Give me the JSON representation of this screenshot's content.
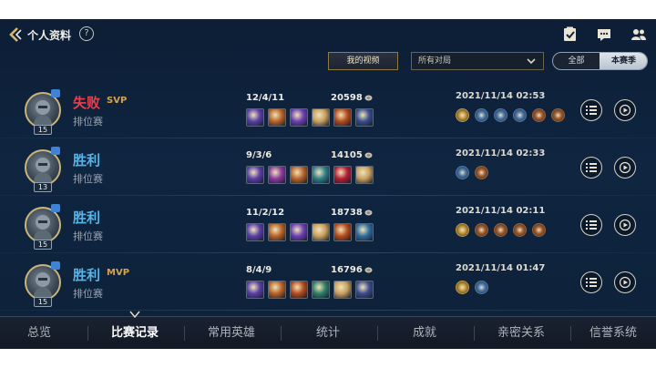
{
  "header": {
    "title": "个人资料",
    "help_symbol": "?",
    "icons": [
      "back-arrow-icon",
      "clipboard-check-icon",
      "chat-icon",
      "friends-icon"
    ]
  },
  "controls": {
    "video_button": "我的视频",
    "filter_value": "所有对局",
    "season_toggle": {
      "all": "全部",
      "current": "本赛季",
      "selected": "本赛季"
    }
  },
  "matches": [
    {
      "result": "失败",
      "result_type": "lose",
      "mvp": "SVP",
      "mvp_color": "#d9a24a",
      "mode": "排位赛",
      "level": "15",
      "kda": "12/4/11",
      "gold": "20598",
      "datetime": "2021/11/14 02:53",
      "items": [
        "#5a3fa8",
        "#b8642a",
        "#6b3fb3",
        "#c9a061",
        "#b54b1c",
        "#3a4e8f"
      ],
      "medals": [
        "gold",
        "silver",
        "silver",
        "silver",
        "bronze",
        "bronze"
      ]
    },
    {
      "result": "胜利",
      "result_type": "win",
      "mvp": "",
      "mvp_color": "#d9a24a",
      "mode": "排位赛",
      "level": "13",
      "kda": "9/3/6",
      "gold": "14105",
      "datetime": "2021/11/14 02:33",
      "items": [
        "#5a3fa8",
        "#8a3a9e",
        "#b8642a",
        "#2f7f8a",
        "#b51e35",
        "#c9a061"
      ],
      "medals": [
        "silver",
        "bronze"
      ]
    },
    {
      "result": "胜利",
      "result_type": "win",
      "mvp": "",
      "mvp_color": "#d9a24a",
      "mode": "排位赛",
      "level": "15",
      "kda": "11/2/12",
      "gold": "18738",
      "datetime": "2021/11/14 02:11",
      "items": [
        "#5a3fa8",
        "#b8642a",
        "#6b3fb3",
        "#c9a061",
        "#b54b1c",
        "#2f6c9e"
      ],
      "medals": [
        "gold",
        "bronze",
        "bronze",
        "bronze",
        "bronze"
      ]
    },
    {
      "result": "胜利",
      "result_type": "win",
      "mvp": "MVP",
      "mvp_color": "#d9a24a",
      "mode": "排位赛",
      "level": "15",
      "kda": "8/4/9",
      "gold": "16796",
      "datetime": "2021/11/14 01:47",
      "items": [
        "#5a3fa8",
        "#b8642a",
        "#b54b1c",
        "#2f7f6a",
        "#c9a061",
        "#3a4e8f"
      ],
      "medals": [
        "gold",
        "silver"
      ]
    }
  ],
  "bottom_nav": {
    "tabs": [
      "总览",
      "比赛记录",
      "常用英雄",
      "统计",
      "成就",
      "亲密关系",
      "信誉系统"
    ],
    "active_index": 1
  },
  "colors": {
    "win": "#55b4e8",
    "lose": "#e5424d",
    "gold": "#c9b57a",
    "medal_gold": "#c79a3c",
    "medal_silver": "#4d78a8",
    "medal_bronze": "#a35f2e"
  }
}
